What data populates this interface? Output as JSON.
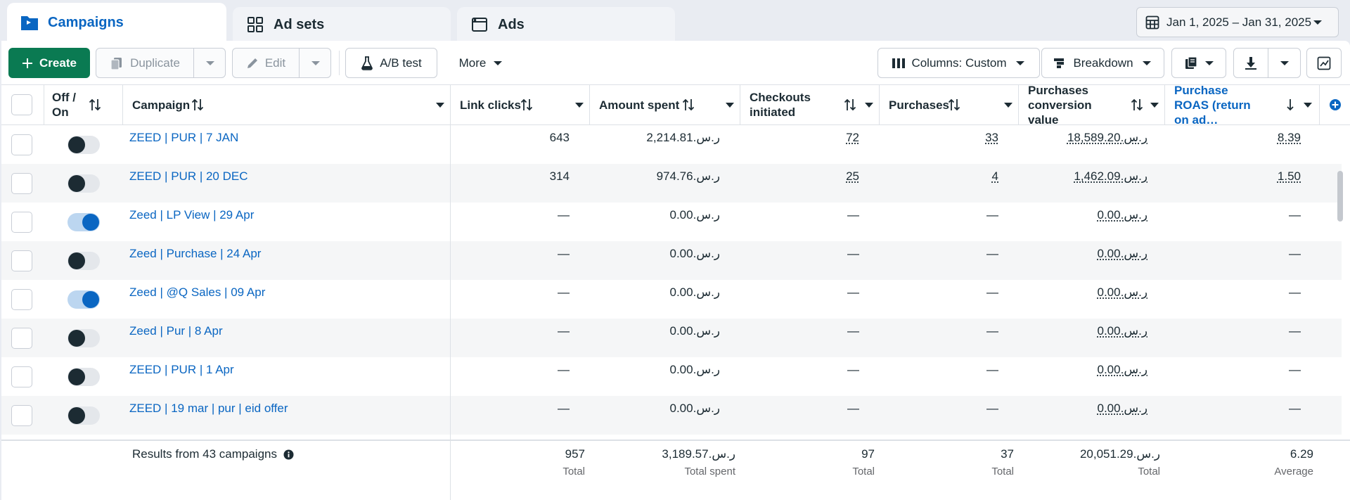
{
  "tabs": [
    {
      "label": "Campaigns",
      "icon": "folder-flag-icon",
      "active": true
    },
    {
      "label": "Ad sets",
      "icon": "grid-icon",
      "active": false
    },
    {
      "label": "Ads",
      "icon": "window-icon",
      "active": false
    }
  ],
  "date_range": "Jan 1, 2025 – Jan 31, 2025",
  "toolbar": {
    "create": "Create",
    "duplicate": "Duplicate",
    "edit": "Edit",
    "ab_test": "A/B test",
    "more": "More",
    "columns": "Columns: Custom",
    "breakdown": "Breakdown"
  },
  "columns": {
    "off_on": "Off / On",
    "campaign": "Campaign",
    "link_clicks": "Link clicks",
    "amount_spent": "Amount spent",
    "checkouts": "Checkouts initiated",
    "purchases": "Purchases",
    "conv_value": "Purchases conversion value",
    "roas": "Purchase ROAS (return on ad…"
  },
  "rows": [
    {
      "name": "ZEED | PUR | 7 JAN",
      "on": false,
      "link_clicks": "643",
      "spent": "2,214.81.ر.س",
      "checkouts": "72",
      "purchases": "33",
      "value": "18,589.20.ر.س",
      "roas": "8.39"
    },
    {
      "name": "ZEED | PUR | 20 DEC",
      "on": false,
      "link_clicks": "314",
      "spent": "974.76.ر.س",
      "checkouts": "25",
      "purchases": "4",
      "value": "1,462.09.ر.س",
      "roas": "1.50"
    },
    {
      "name": "Zeed | LP View | 29 Apr",
      "on": true,
      "link_clicks": "—",
      "spent": "0.00.ر.س",
      "checkouts": "—",
      "purchases": "—",
      "value": "0.00.ر.س",
      "roas": "—"
    },
    {
      "name": "Zeed | Purchase | 24 Apr",
      "on": false,
      "link_clicks": "—",
      "spent": "0.00.ر.س",
      "checkouts": "—",
      "purchases": "—",
      "value": "0.00.ر.س",
      "roas": "—"
    },
    {
      "name": "Zeed | @Q Sales | 09 Apr",
      "on": true,
      "link_clicks": "—",
      "spent": "0.00.ر.س",
      "checkouts": "—",
      "purchases": "—",
      "value": "0.00.ر.س",
      "roas": "—"
    },
    {
      "name": "Zeed | Pur | 8 Apr",
      "on": false,
      "link_clicks": "—",
      "spent": "0.00.ر.س",
      "checkouts": "—",
      "purchases": "—",
      "value": "0.00.ر.س",
      "roas": "—"
    },
    {
      "name": "ZEED | PUR | 1 Apr",
      "on": false,
      "link_clicks": "—",
      "spent": "0.00.ر.س",
      "checkouts": "—",
      "purchases": "—",
      "value": "0.00.ر.س",
      "roas": "—"
    },
    {
      "name": "ZEED | 19 mar | pur | eid offer",
      "on": false,
      "link_clicks": "—",
      "spent": "0.00.ر.س",
      "checkouts": "—",
      "purchases": "—",
      "value": "0.00.ر.س",
      "roas": "—"
    }
  ],
  "totals": {
    "label": "Results from 43 campaigns",
    "link_clicks": "957",
    "link_clicks_sub": "Total",
    "spent": "3,189.57.ر.س",
    "spent_sub": "Total spent",
    "checkouts": "97",
    "checkouts_sub": "Total",
    "purchases": "37",
    "purchases_sub": "Total",
    "value": "20,051.29.ر.س",
    "value_sub": "Total",
    "roas": "6.29",
    "roas_sub": "Average"
  },
  "colors": {
    "accent": "#0a66c2",
    "primary_button": "#0a7a52"
  }
}
